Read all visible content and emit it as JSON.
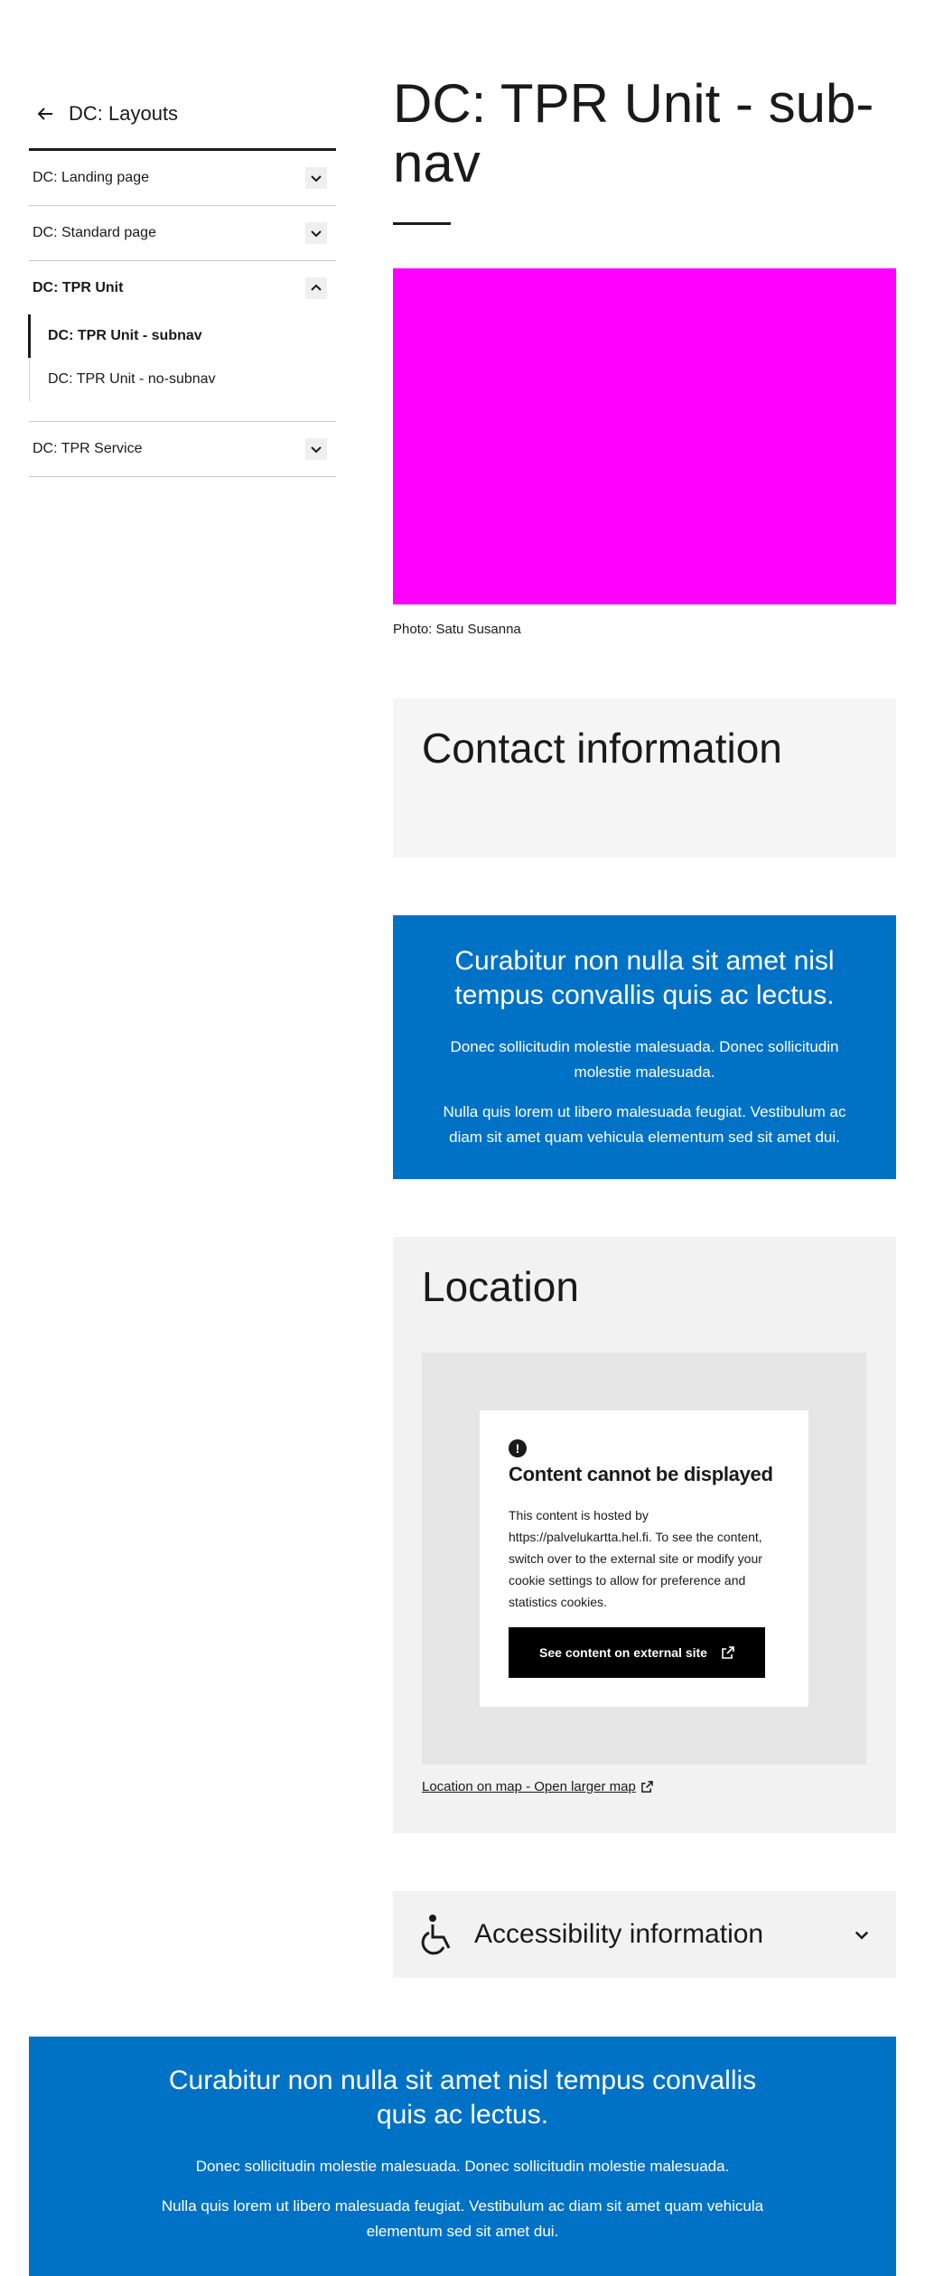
{
  "sidebar": {
    "back_label": "DC: Layouts",
    "items": [
      {
        "label": "DC: Landing page",
        "expanded": false
      },
      {
        "label": "DC: Standard page",
        "expanded": false
      },
      {
        "label": "DC: TPR Unit",
        "expanded": true,
        "children": [
          {
            "label": "DC: TPR Unit - subnav",
            "active": true
          },
          {
            "label": "DC: TPR Unit - no-subnav",
            "active": false
          }
        ]
      },
      {
        "label": "DC: TPR Service",
        "expanded": false
      }
    ]
  },
  "main": {
    "title": "DC: TPR Unit - sub-nav",
    "hero_image_color": "#ff00ff",
    "photo_caption": "Photo: Satu Susanna",
    "contact": {
      "heading": "Contact information"
    },
    "promo": {
      "heading": "Curabitur non nulla sit amet nisl tempus convallis quis ac lectus.",
      "paragraph1": "Donec sollicitudin molestie malesuada. Donec sollicitudin molestie malesuada.",
      "paragraph2": "Nulla quis lorem ut libero malesuada feugiat. Vestibulum ac diam sit amet quam vehicula elementum sed sit amet dui."
    },
    "location": {
      "heading": "Location",
      "notice_icon": "exclamation-icon",
      "notice_title": "Content cannot be displayed",
      "notice_body": "This content is hosted by https://palvelukartta.hel.fi. To see the content, switch over to the external site or modify your cookie settings to allow for preference and statistics cookies.",
      "button_label": "See content on external site",
      "map_link": "Location on map - Open larger map"
    },
    "accessibility": {
      "label": "Accessibility information",
      "icon": "wheelchair-icon"
    }
  },
  "bottom_promo": {
    "heading": "Curabitur non nulla sit amet nisl tempus convallis quis ac lectus.",
    "paragraph1": "Donec sollicitudin molestie malesuada. Donec sollicitudin molestie malesuada.",
    "paragraph2": "Nulla quis lorem ut libero malesuada feugiat. Vestibulum ac diam sit amet quam vehicula elementum sed sit amet dui."
  },
  "colors": {
    "brand_blue": "#0072c6",
    "panel_gray": "#f2f2f2",
    "text": "#1a1a1a"
  }
}
